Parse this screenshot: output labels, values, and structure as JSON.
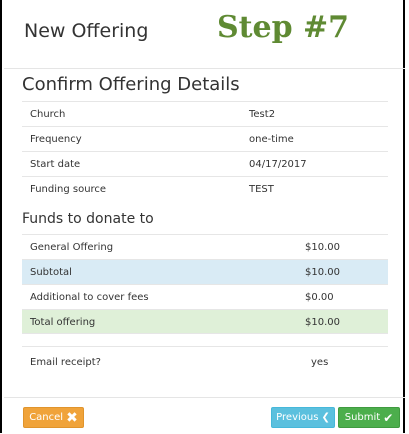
{
  "header": {
    "title": "New Offering",
    "step": "Step #7"
  },
  "confirm": {
    "title": "Confirm Offering Details",
    "rows": [
      {
        "label": "Church",
        "value": "Test2"
      },
      {
        "label": "Frequency",
        "value": "one-time"
      },
      {
        "label": "Start date",
        "value": "04/17/2017"
      },
      {
        "label": "Funding source",
        "value": "TEST"
      }
    ]
  },
  "funds": {
    "title": "Funds to donate to",
    "rows": [
      {
        "label": "General Offering",
        "value": "$10.00"
      },
      {
        "label": "Subtotal",
        "value": "$10.00"
      },
      {
        "label": "Additional to cover fees",
        "value": "$0.00"
      },
      {
        "label": "Total offering",
        "value": "$10.00"
      }
    ]
  },
  "email": {
    "label": "Email receipt?",
    "value": "yes"
  },
  "footer": {
    "cancel_label": "Cancel",
    "previous_label": "Previous",
    "submit_label": "Submit"
  },
  "icons": {
    "cancel": "close-icon",
    "previous": "chevron-left-icon",
    "submit": "check-icon"
  },
  "colors": {
    "step": "#5f8a33",
    "cancel": "#f0a33a",
    "previous": "#5bc0de",
    "submit": "#4cae4c",
    "subtotal_bg": "#d9ebf5",
    "total_bg": "#dff0d8"
  }
}
